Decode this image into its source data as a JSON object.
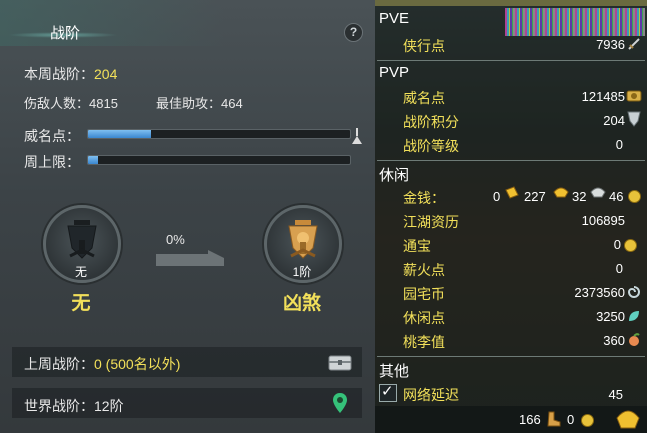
{
  "left": {
    "title": "战阶",
    "help": "?",
    "weekly_rank_label": "本周战阶：",
    "weekly_rank_value": "204",
    "kills_label": "伤敌人数：",
    "kills_value": "4815",
    "assists_label": "最佳助攻：",
    "assists_value": "464",
    "prestige_label": "威名点：",
    "prestige_progress": 0.24,
    "weekly_cap_label": "周上限：",
    "weekly_cap_progress": 0.04,
    "current_rank_small": "无",
    "current_rank_big": "无",
    "progress_percent": "0%",
    "next_rank_small": "1阶",
    "next_rank_big": "凶煞",
    "last_week_label": "上周战阶：",
    "last_week_value": "0 (500名以外)",
    "world_label": "世界战阶：",
    "world_value": "12阶"
  },
  "right": {
    "pve_header": "PVE",
    "xiaxing_label": "侠行点",
    "xiaxing_value": "7936",
    "pvp_header": "PVP",
    "weiming_label": "威名点",
    "weiming_value": "121485",
    "zhanjie_points_label": "战阶积分",
    "zhanjie_points_value": "204",
    "zhanjie_level_label": "战阶等级",
    "zhanjie_level_value": "0",
    "leisure_header": "休闲",
    "gold_label": "金钱：",
    "gold_zero": "0",
    "gold_a": "227",
    "gold_b": "32",
    "gold_c": "46",
    "jianghu_label": "江湖资历",
    "jianghu_value": "106895",
    "tongbao_label": "通宝",
    "tongbao_value": "0",
    "xinhuo_label": "薪火点",
    "xinhuo_value": "0",
    "yuanzhai_label": "园宅币",
    "yuanzhai_value": "2373560",
    "xiuxian_label": "休闲点",
    "xiuxian_value": "3250",
    "taoli_label": "桃李值",
    "taoli_value": "360",
    "other_header": "其他",
    "latency_label": "网络延迟",
    "latency_value": "45",
    "footer_a": "166",
    "footer_b": "0"
  }
}
